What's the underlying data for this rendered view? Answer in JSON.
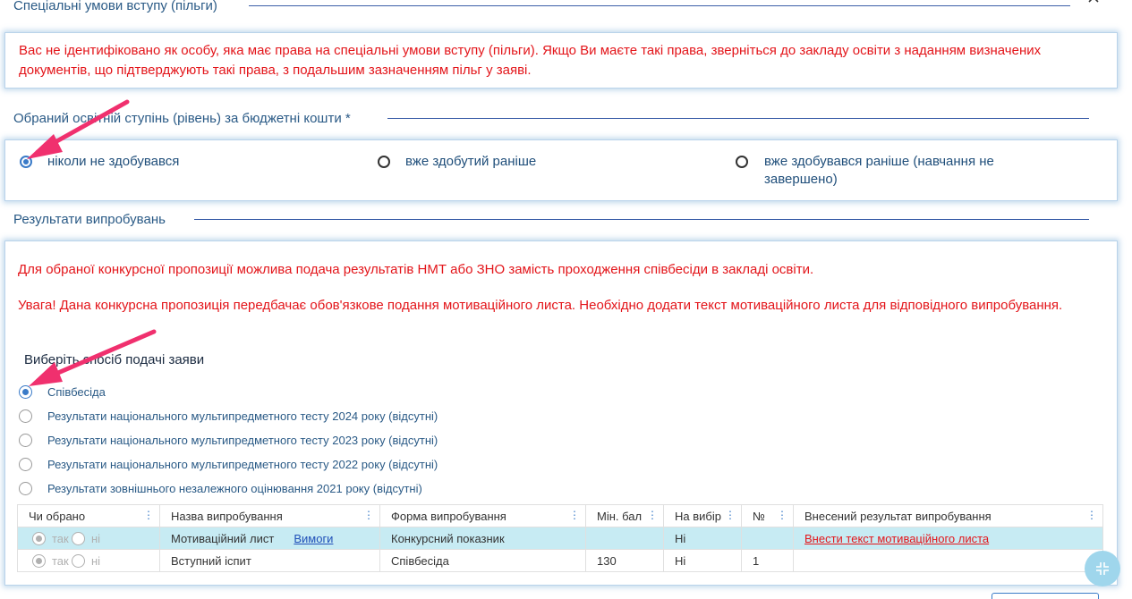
{
  "section_benefits": {
    "title": "Спеціальні умови вступу (пільги)",
    "collapse_icon": "chevron-up-icon",
    "message": "Вас не ідентифіковано як особу, яка має права на спеціальні умови вступу (пільги). Якщо Ви маєте такі права, зверніться до закладу освіти з наданням визначених документів, що підтверджують такі права, з подальшим зазначенням пільг у заяві."
  },
  "section_degree": {
    "title": "Обраний освітній ступінь (рівень) за бюджетні кошти *",
    "options": [
      {
        "label": "ніколи не здобувався",
        "selected": true
      },
      {
        "label": "вже здобутий раніше",
        "selected": false
      },
      {
        "label": "вже здобувався раніше (навчання не завершено)",
        "selected": false
      }
    ]
  },
  "section_results": {
    "title": "Результати випробувань",
    "notice1": "Для обраної конкурсної пропозиції можлива подача результатів НМТ або ЗНО замість проходження співбесіди в закладі освіти.",
    "notice2": "Увага! Дана конкурсна пропозиція передбачає обов'язкове подання мотиваційного листа. Необхідно додати текст мотиваційного листа для відповідного випробування.",
    "method_title": "Виберіть спосіб подачі заяви",
    "methods": [
      {
        "label": "Співбесіда",
        "selected": true
      },
      {
        "label": "Результати національного мультипредметного тесту 2024 року (відсутні)",
        "selected": false
      },
      {
        "label": "Результати національного мультипредметного тесту 2023 року (відсутні)",
        "selected": false
      },
      {
        "label": "Результати національного мультипредметного тесту 2022 року (відсутні)",
        "selected": false
      },
      {
        "label": "Результати зовнішнього незалежного оцінювання 2021 року (відсутні)",
        "selected": false
      }
    ],
    "table": {
      "columns": [
        "Чи обрано",
        "Назва випробування",
        "Форма випробування",
        "Мін. бал",
        "На вибір",
        "№",
        "Внесений результат випробування"
      ],
      "column_menu_icon": "column-menu-icon",
      "yes_label": "так",
      "no_label": "ні",
      "rows": [
        {
          "name": "Мотиваційний лист",
          "link": "Вимоги",
          "form": "Конкурсний показник",
          "min": "",
          "choice": "Ні",
          "num": "",
          "result": "Внести текст мотиваційного листа"
        },
        {
          "name": "Вступний іспит",
          "link": "",
          "form": "Співбесіда",
          "min": "130",
          "choice": "Ні",
          "num": "1",
          "result": ""
        }
      ]
    }
  },
  "colors": {
    "accent": "#3a7bc8",
    "warning": "#e3151a",
    "highlight_row": "#c7ebf3",
    "annotation_arrow": "#f0306e"
  },
  "fab_icon": "collapse-icon"
}
